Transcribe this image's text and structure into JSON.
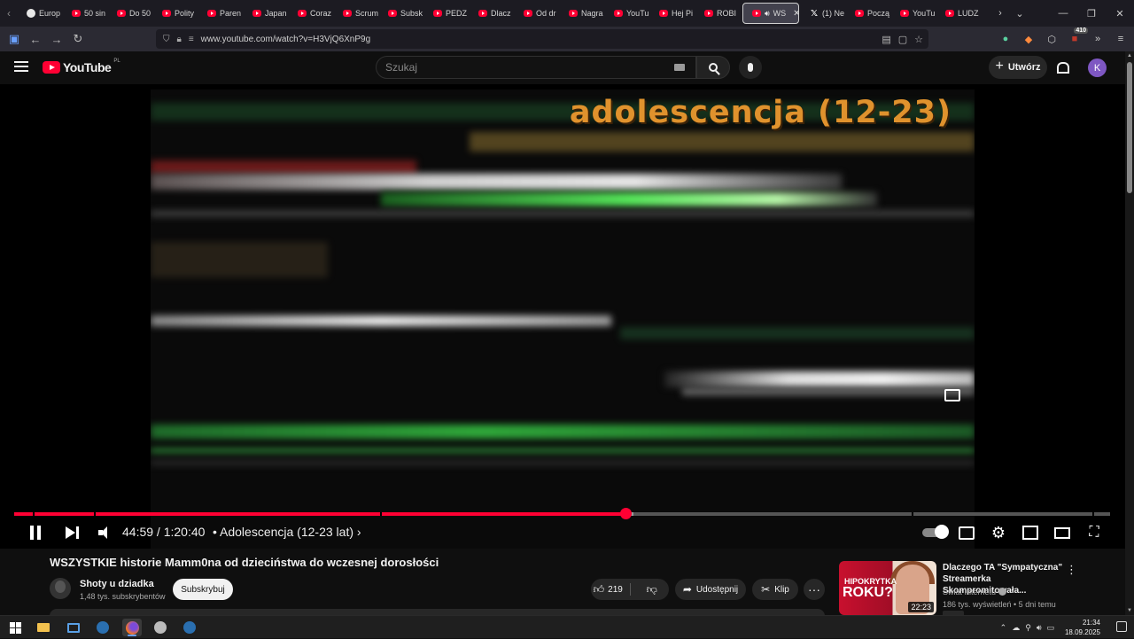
{
  "browser": {
    "tabs": [
      {
        "label": "Europ",
        "icon": "globe-icon"
      },
      {
        "label": "50 sin",
        "icon": "youtube-icon"
      },
      {
        "label": "Do 50",
        "icon": "youtube-icon"
      },
      {
        "label": "Polity",
        "icon": "youtube-icon"
      },
      {
        "label": "Paren",
        "icon": "youtube-icon"
      },
      {
        "label": "Japan",
        "icon": "youtube-icon"
      },
      {
        "label": "Coraz",
        "icon": "youtube-icon"
      },
      {
        "label": "Scrum",
        "icon": "youtube-icon"
      },
      {
        "label": "Subsk",
        "icon": "youtube-icon"
      },
      {
        "label": "PEDZ",
        "icon": "youtube-icon"
      },
      {
        "label": "Dlacz",
        "icon": "youtube-icon"
      },
      {
        "label": "Od dr",
        "icon": "youtube-icon"
      },
      {
        "label": "Nagra",
        "icon": "youtube-icon"
      },
      {
        "label": "YouTu",
        "icon": "youtube-icon"
      },
      {
        "label": "Hej Pi",
        "icon": "youtube-icon"
      },
      {
        "label": "ROBI",
        "icon": "youtube-icon"
      },
      {
        "label": "WS",
        "icon": "youtube-icon",
        "active": true
      },
      {
        "label": "(1) Ne",
        "icon": "x-icon"
      },
      {
        "label": "Począ",
        "icon": "youtube-icon"
      },
      {
        "label": "YouTu",
        "icon": "youtube-icon"
      },
      {
        "label": "LUDZ",
        "icon": "youtube-icon"
      }
    ],
    "url": "www.youtube.com/watch?v=H3VjQ6XnP9g",
    "extension_badge": "410"
  },
  "youtube": {
    "logo_text": "YouTube",
    "region": "PL",
    "search_placeholder": "Szukaj",
    "create_label": "Utwórz",
    "avatar_letter": "K",
    "accent": "#ff0033"
  },
  "video": {
    "overlay_text": "adolescencja (12-23)",
    "current_time": "44:59",
    "duration": "1:20:40",
    "separator": " / ",
    "chapter": "• Adolescencja (12-23 lat) ›",
    "progress_fraction": 0.5575,
    "buffered_fraction": 0.565,
    "chapter_gap_fractions": [
      0.017,
      0.073,
      0.334,
      0.819,
      0.984
    ]
  },
  "details": {
    "title": "WSZYSTKIE historie Mamm0na od dzieciństwa do wczesnej dorosłości",
    "channel_name": "Shoty u dziadka",
    "channel_subs": "1,48 tys. subskrybentów",
    "subscribe_label": "Subskrybuj",
    "like_count": "219",
    "share_label": "Udostępnij",
    "clip_label": "Klip"
  },
  "recommendation": {
    "title": "Dlaczego TA \"Sympatyczna\" Streamerka Skompromitowała...",
    "channel": "Świat Internetu",
    "meta": "186 tys. wyświetleń • 5 dni temu",
    "duration": "22:23",
    "thumb_line1": "HIPOKRYTKA",
    "thumb_line2": "ROKU?"
  },
  "taskbar": {
    "time": "21:34",
    "date": "18.09.2025"
  }
}
